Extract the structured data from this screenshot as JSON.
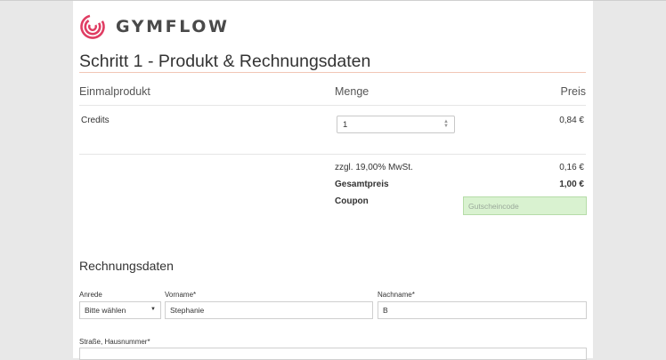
{
  "brand": {
    "name": "GYMFLOW",
    "accent": "#e03d63"
  },
  "step_title": "Schritt 1 - Produkt & Rechnungsdaten",
  "table": {
    "headers": {
      "product": "Einmalprodukt",
      "quantity": "Menge",
      "price": "Preis"
    },
    "rows": [
      {
        "product": "Credits",
        "quantity": "1",
        "price": "0,84 €"
      }
    ]
  },
  "summary": {
    "vat_label": "zzgl. 19,00% MwSt.",
    "vat_value": "0,16 €",
    "total_label": "Gesamtpreis",
    "total_value": "1,00 €",
    "coupon_label": "Coupon",
    "coupon_placeholder": "Gutscheincode"
  },
  "billing": {
    "title": "Rechnungsdaten",
    "salutation": {
      "label": "Anrede",
      "value": "Bitte wählen"
    },
    "first_name": {
      "label": "Vorname*",
      "value": "Stephanie"
    },
    "last_name": {
      "label": "Nachname*",
      "value": "B"
    },
    "street": {
      "label": "Straße, Hausnummer*",
      "value": ""
    }
  },
  "colors": {
    "rule": "#f2c7b6",
    "coupon_bg": "#d9f2d0"
  }
}
